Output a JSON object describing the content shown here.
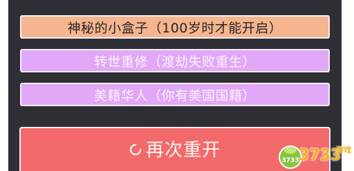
{
  "options": [
    {
      "label": "神秘的小盒子（100岁时才能开启）",
      "selected": true
    },
    {
      "label": "转世重修（渡劫失败重生）",
      "selected": false
    },
    {
      "label": "美籍华人（你有美国国籍）",
      "selected": false
    }
  ],
  "restart_button": {
    "label": "再次重开",
    "icon": "restart-icon"
  },
  "watermark": {
    "text": "3733",
    "sub": "游戏",
    "badge": "3733"
  },
  "colors": {
    "panel_bg": "#2f2e35",
    "option_bg": "#e0a8f6",
    "option_selected_bg": "#f4b58f",
    "restart_bg": "#f36a6a",
    "border": "#f7eef7",
    "watermark": "#f1b01b"
  }
}
